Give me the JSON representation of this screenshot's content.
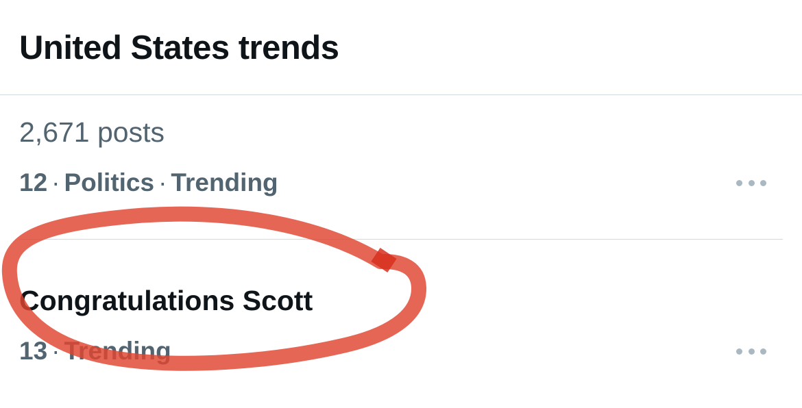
{
  "header": {
    "title": "United States trends"
  },
  "trends": [
    {
      "posts": "2,671 posts",
      "rank": "12",
      "category": "Politics",
      "status": "Trending"
    },
    {
      "name": "Congratulations Scott",
      "rank": "13",
      "status": "Trending"
    }
  ],
  "colors": {
    "primary_text": "#0f1419",
    "secondary_text": "#536471",
    "divider": "#cfd9de",
    "annotation": "#e0442f"
  },
  "icons": {
    "more": "more-horizontal-icon"
  }
}
